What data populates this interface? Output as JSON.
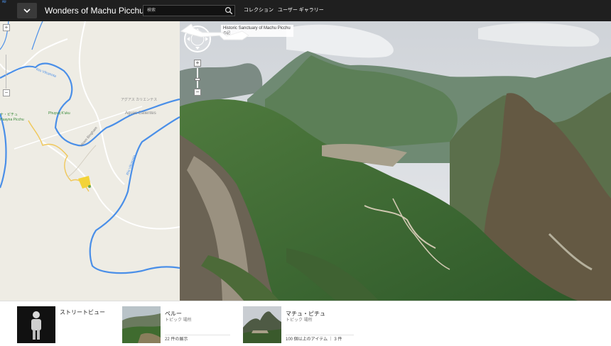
{
  "header": {
    "title": "Wonders of Machu Picchu",
    "search_placeholder": "検索",
    "nav": [
      "コレクション",
      "ユーザー ギャラリー"
    ]
  },
  "map": {
    "labels": {
      "river": "Río Vilcanota",
      "town_name": "アグアス カリエンテス",
      "town_name_latin": "Aguas Calientes",
      "ruins_name": "ナ・ピチュ",
      "ruins_name_latin": "Huayna Picchu",
      "peak": "Phuyuq K'uku",
      "road": "Hiram Bingham",
      "river2": "Río Vilcanota"
    },
    "zoom_in": "+",
    "zoom_out": "−"
  },
  "panorama": {
    "caption_title": "Historic Sanctuary of Machu Picchu",
    "caption_sub": "の記"
  },
  "cards": [
    {
      "title": "ストリートビュー",
      "icon": "pegman-icon"
    },
    {
      "title": "ペルー",
      "subtitle": "トピック 場所",
      "footer": "22 件の展示"
    },
    {
      "title": "マチュ・ピチュ",
      "subtitle": "トピック 場所",
      "footer": "100 個以上のアイテム ｜ 3 件"
    }
  ],
  "colors": {
    "topbar": "#1f1f1f",
    "map_background": "#eeece4",
    "river": "#4a8fe8",
    "road": "#f0c85a"
  }
}
